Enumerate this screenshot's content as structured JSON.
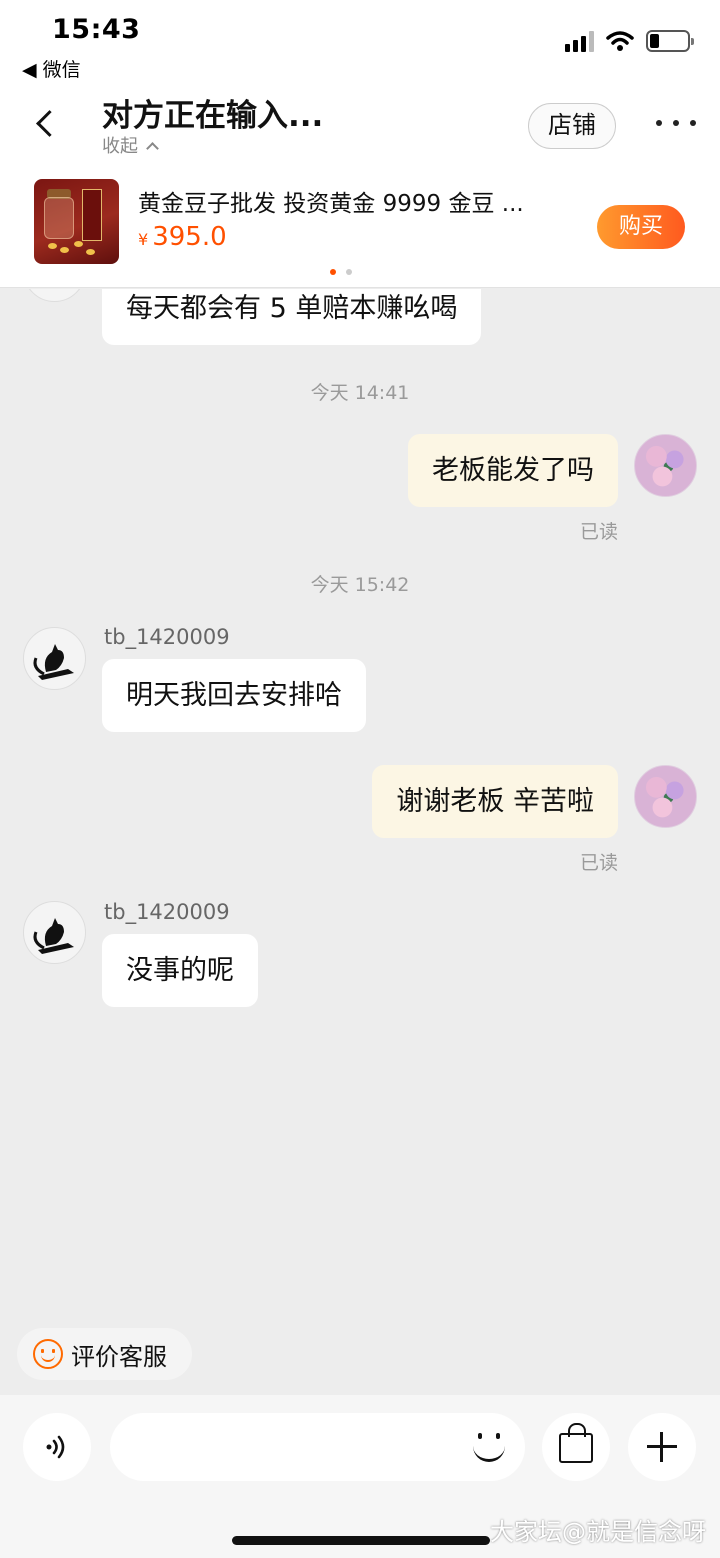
{
  "status_bar": {
    "time": "15:43",
    "back_app": "◀ 微信",
    "icons": [
      "signal-icon",
      "wifi-icon",
      "battery-icon"
    ]
  },
  "header": {
    "title": "对方正在输入...",
    "collapse_label": "收起",
    "store_button": "店铺",
    "more_icon": "more-icon"
  },
  "product": {
    "name": "黄金豆子批发 投资黄金 9999 金豆 ...",
    "currency": "¥",
    "price": "395.0",
    "buy_button": "购买",
    "thumb_text": "金豆小金库"
  },
  "messages": {
    "m1": {
      "text": "每天都会有 5 单赔本赚吆喝",
      "side": "in"
    },
    "time1": "今天 14:41",
    "m2": {
      "text": "老板能发了吗",
      "side": "out",
      "status": "已读"
    },
    "time2": "今天 15:42",
    "m3": {
      "sender": "tb_1420009",
      "text": "明天我回去安排哈",
      "side": "in"
    },
    "m4": {
      "text": "谢谢老板 辛苦啦",
      "side": "out",
      "status": "已读"
    },
    "m5": {
      "sender": "tb_1420009",
      "text": "没事的呢",
      "side": "in"
    }
  },
  "rate_service": {
    "label": "评价客服",
    "icon": "smile-icon"
  },
  "input_bar": {
    "placeholder": "",
    "voice_icon": "voice-icon",
    "emoji_icon": "emoji-icon",
    "bag_icon": "shopping-bag-icon",
    "plus_icon": "plus-icon"
  },
  "watermark": "大家坛@就是信念呀",
  "colors": {
    "accent": "#ff5000",
    "outgoing_bubble": "#fcf6e4",
    "incoming_bubble": "#ffffff",
    "chat_background": "#ededed"
  }
}
